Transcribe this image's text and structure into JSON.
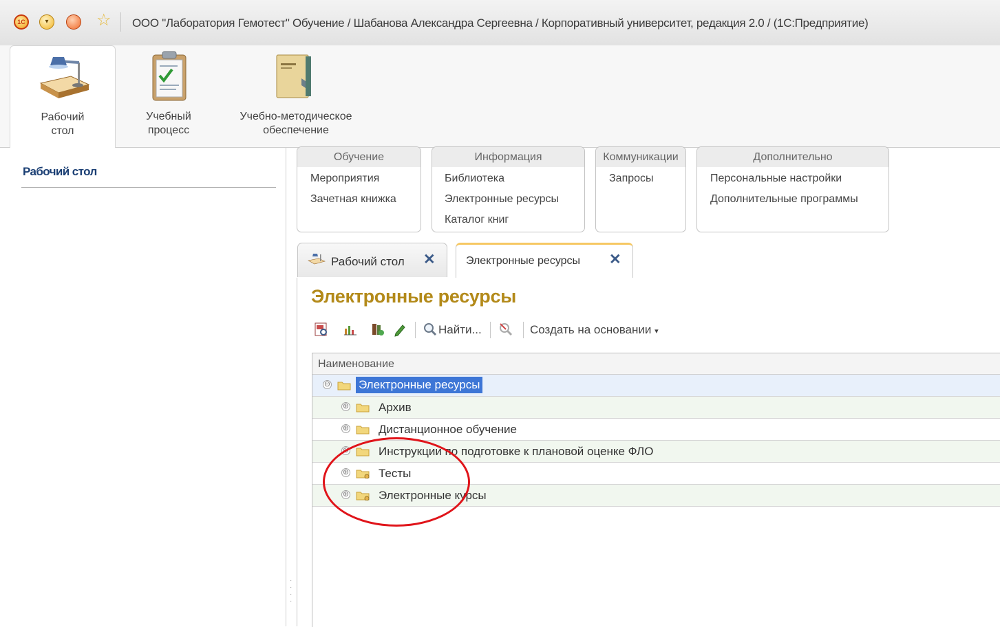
{
  "window": {
    "title": "ООО \"Лаборатория Гемотест\" Обучение / Шабанова Александра Сергеевна / Корпоративный университет, редакция 2.0 /  (1С:Предприятие)",
    "logo_text": "1С"
  },
  "sections": [
    {
      "label_line1": "Рабочий",
      "label_line2": "стол",
      "icon": "desk-lamp-icon",
      "active": true
    },
    {
      "label_line1": "Учебный",
      "label_line2": "процесс",
      "icon": "clipboard-check-icon",
      "active": false
    },
    {
      "label_line1": "Учебно-методическое",
      "label_line2": "обеспечение",
      "icon": "folder-book-icon",
      "active": false
    }
  ],
  "left_panel": {
    "title": "Рабочий стол"
  },
  "command_groups": [
    {
      "header": "Обучение",
      "items": [
        "Мероприятия",
        "Зачетная книжка"
      ]
    },
    {
      "header": "Информация",
      "items": [
        "Библиотека",
        "Электронные ресурсы",
        "Каталог книг"
      ]
    },
    {
      "header": "Коммуникации",
      "items": [
        "Запросы"
      ]
    },
    {
      "header": "Дополнительно",
      "items": [
        "Персональные настройки",
        "Дополнительные программы"
      ]
    }
  ],
  "tabs": [
    {
      "label": "Рабочий стол",
      "active": false,
      "close": "✕"
    },
    {
      "label": "Электронные ресурсы",
      "active": true,
      "close": "✕"
    }
  ],
  "form": {
    "title": "Электронные ресурсы",
    "toolbar": {
      "find_label": "Найти...",
      "create_based_label": "Создать на основании"
    },
    "table": {
      "column_header": "Наименование",
      "root": {
        "name": "Электронные ресурсы",
        "expander": "⊖"
      },
      "rows": [
        {
          "name": "Архив",
          "expander": "⊕"
        },
        {
          "name": "Дистанционное обучение",
          "expander": "⊕"
        },
        {
          "name": "Инструкции по подготовке к плановой оценке ФЛО",
          "expander": "⊕"
        },
        {
          "name": "Тесты",
          "expander": "⊕"
        },
        {
          "name": "Электронные курсы",
          "expander": "⊕"
        }
      ]
    }
  },
  "colors": {
    "accent_title": "#b38a1a",
    "selection": "#3d76d6",
    "annotation": "#e0141a"
  }
}
